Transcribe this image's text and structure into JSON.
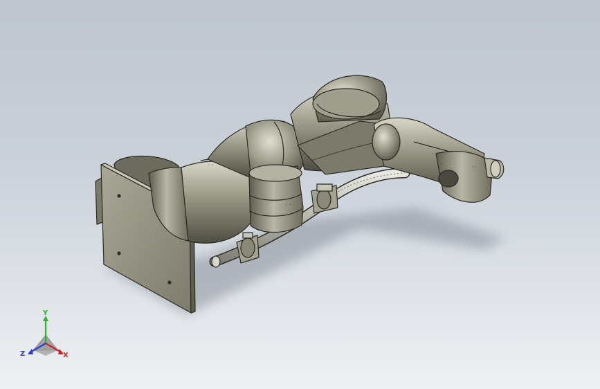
{
  "view": {
    "background_top": "#bfc6cf",
    "background_bottom": "#eef0f2",
    "model_color": "#8d8c7a"
  },
  "triad": {
    "x_label": "X",
    "y_label": "Y",
    "z_label": "Z",
    "x_color": "#d42020",
    "y_color": "#2bb52b",
    "z_color": "#2a3bd8"
  }
}
